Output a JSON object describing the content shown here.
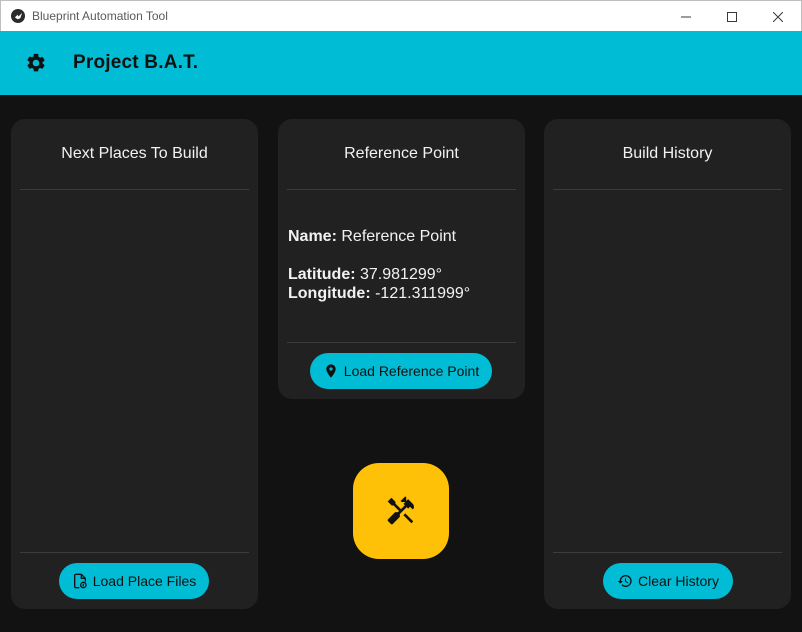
{
  "window": {
    "title": "Blueprint Automation Tool"
  },
  "appbar": {
    "title": "Project B.A.T.",
    "settings_icon": "gear-icon"
  },
  "colors": {
    "accent": "#00bcd4",
    "build_button": "#ffc107",
    "card": "#212121",
    "background": "#121212"
  },
  "next_places": {
    "title": "Next Places To Build",
    "items": [],
    "load_button": {
      "label": "Load Place Files",
      "icon": "file-upload-icon"
    }
  },
  "reference_point": {
    "title": "Reference Point",
    "name_label": "Name:",
    "name_value": "Reference Point",
    "latitude_label": "Latitude:",
    "latitude_value": "37.981299°",
    "longitude_label": "Longitude:",
    "longitude_value": "-121.311999°",
    "load_button": {
      "label": "Load Reference Point",
      "icon": "map-marker-icon"
    }
  },
  "build_history": {
    "title": "Build History",
    "items": [],
    "clear_button": {
      "label": "Clear History",
      "icon": "history-icon"
    }
  },
  "build_button": {
    "icon": "hammer-wrench-icon"
  }
}
